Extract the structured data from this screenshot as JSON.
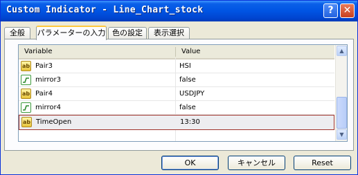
{
  "window": {
    "title": "Custom Indicator - Line_Chart_stock",
    "help_label": "?",
    "close_label": "✕"
  },
  "tabs": [
    {
      "label": "全般"
    },
    {
      "label": "パラメーターの入力"
    },
    {
      "label": "色の設定"
    },
    {
      "label": "表示選択"
    }
  ],
  "grid": {
    "headers": {
      "variable": "Variable",
      "value": "Value"
    },
    "rows": [
      {
        "icon": "ab-string-icon",
        "icon_text": "ab",
        "name": "Pair3",
        "value": "HSI"
      },
      {
        "icon": "bool-icon",
        "icon_text": "",
        "name": "mirror3",
        "value": "false"
      },
      {
        "icon": "ab-string-icon",
        "icon_text": "ab",
        "name": "Pair4",
        "value": "USDJPY"
      },
      {
        "icon": "bool-icon",
        "icon_text": "",
        "name": "mirror4",
        "value": "false"
      },
      {
        "icon": "ab-string-icon",
        "icon_text": "ab",
        "name": "TimeOpen",
        "value": "13:30"
      }
    ]
  },
  "scrollbar": {
    "up_label": "▲",
    "down_label": "▼"
  },
  "buttons": {
    "ok": "OK",
    "cancel": "キャンセル",
    "reset": "Reset"
  }
}
